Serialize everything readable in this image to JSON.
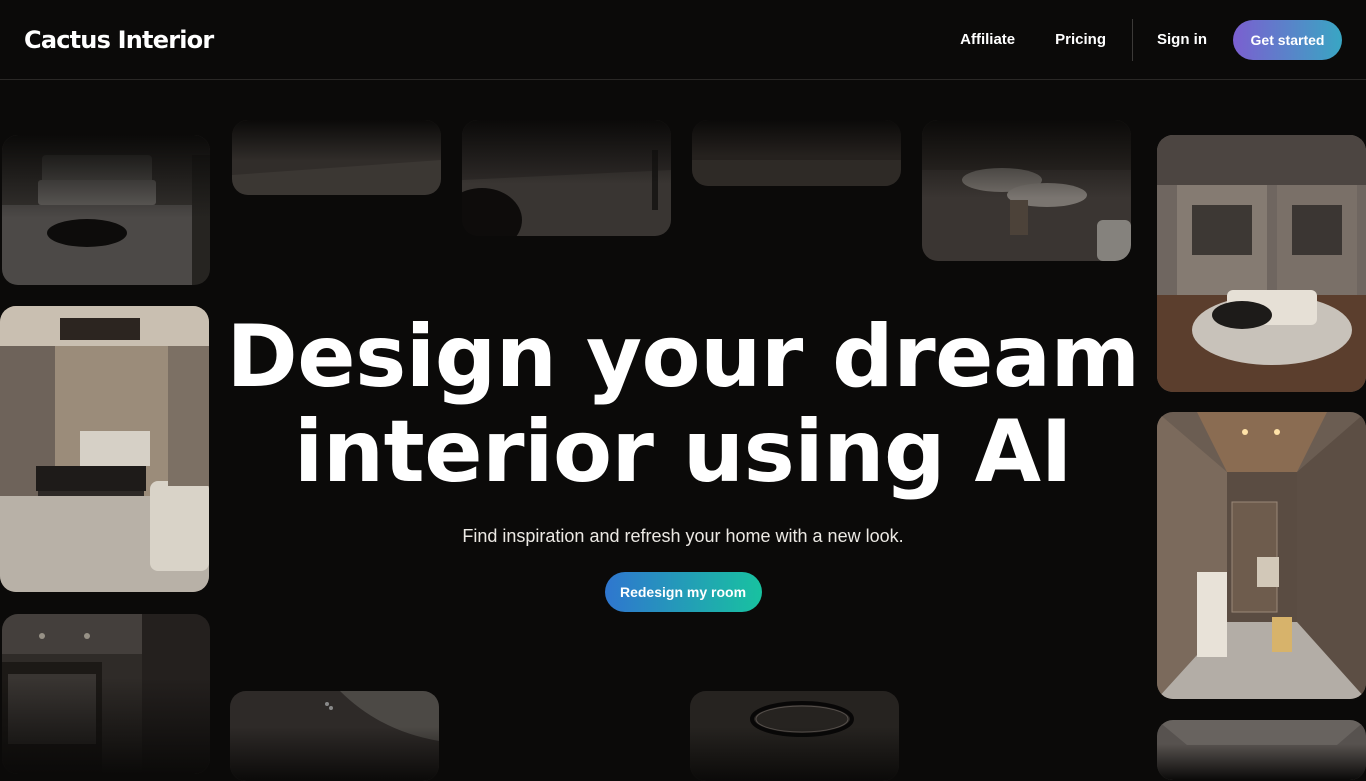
{
  "header": {
    "logo": "Cactus Interior",
    "nav": {
      "affiliate": "Affiliate",
      "pricing": "Pricing",
      "sign_in": "Sign in",
      "get_started": "Get started"
    }
  },
  "hero": {
    "title_line1": "Design your dream",
    "title_line2": "interior using AI",
    "subtitle": "Find inspiration and refresh your home with a new look.",
    "cta": "Redesign my room"
  },
  "gallery": [
    {
      "name": "bedroom-grey-photo"
    },
    {
      "name": "floor-photo"
    },
    {
      "name": "armchair-floor-photo"
    },
    {
      "name": "dark-floor-photo"
    },
    {
      "name": "dining-table-photo"
    },
    {
      "name": "walk-in-closet-photo"
    },
    {
      "name": "luxury-bedroom-photo"
    },
    {
      "name": "hallway-photo"
    },
    {
      "name": "wardrobe-photo"
    },
    {
      "name": "mirror-room-photo"
    },
    {
      "name": "ceiling-light-photo"
    },
    {
      "name": "ceiling-room-photo"
    }
  ],
  "colors": {
    "background": "#0b0a09",
    "get_started_gradient": [
      "#7b5fd0",
      "#39a6c3"
    ],
    "cta_gradient": [
      "#2f76cf",
      "#18c2a0"
    ]
  }
}
